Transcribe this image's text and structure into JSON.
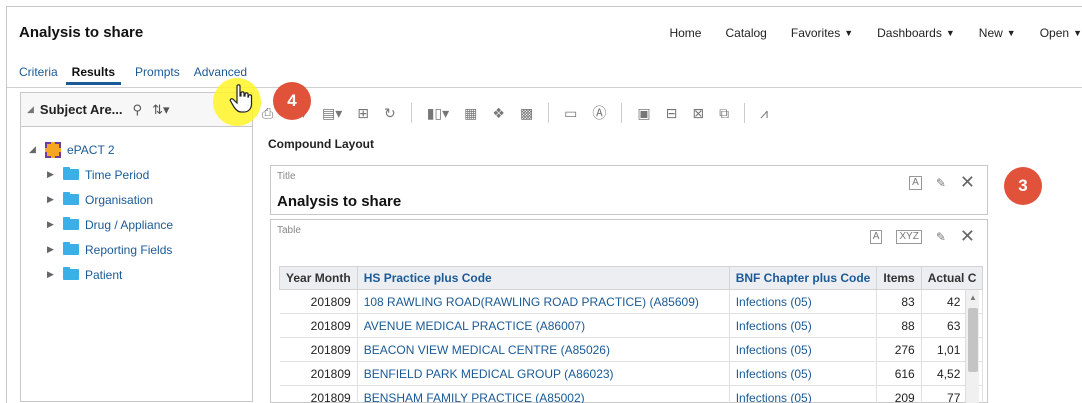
{
  "app": {
    "title": "Analysis to share",
    "nav": [
      {
        "label": "Home",
        "caret": ""
      },
      {
        "label": "Catalog",
        "caret": ""
      },
      {
        "label": "Favorites",
        "caret": "▼"
      },
      {
        "label": "Dashboards",
        "caret": "▼"
      },
      {
        "label": "New",
        "caret": "▼"
      },
      {
        "label": "Open",
        "caret": "▼"
      }
    ]
  },
  "tabs": {
    "criteria": "Criteria",
    "results": "Results",
    "prompts": "Prompts",
    "advanced": "Advanced"
  },
  "subject_panel": {
    "header": "Subject Are...",
    "root": "ePACT 2",
    "folders": [
      "Time Period",
      "Organisation",
      "Drug / Appliance",
      "Reporting Fields",
      "Patient"
    ]
  },
  "compound_layout": {
    "label": "Compound Layout",
    "title_view": {
      "label": "Title",
      "title": "Analysis to share"
    },
    "table_view": {
      "label": "Table"
    }
  },
  "table": {
    "columns": [
      "Year Month",
      "HS Practice plus Code",
      "BNF Chapter plus Code",
      "Items",
      "Actual C"
    ],
    "rows": [
      [
        "201809",
        "108 RAWLING ROAD(RAWLING ROAD PRACTICE) (A85609)",
        "Infections (05)",
        "83",
        "42"
      ],
      [
        "201809",
        "AVENUE MEDICAL PRACTICE (A86007)",
        "Infections (05)",
        "88",
        "63"
      ],
      [
        "201809",
        "BEACON VIEW MEDICAL CENTRE (A85026)",
        "Infections (05)",
        "276",
        "1,01"
      ],
      [
        "201809",
        "BENFIELD PARK MEDICAL GROUP (A86023)",
        "Infections (05)",
        "616",
        "4,52"
      ],
      [
        "201809",
        "BENSHAM FAMILY PRACTICE (A85002)",
        "Infections (05)",
        "209",
        "77"
      ]
    ]
  },
  "callouts": {
    "step4": "4",
    "step3": "3"
  },
  "colors": {
    "accent": "#1a5a96",
    "badge": "#e0533a",
    "folder": "#3bb0e8"
  }
}
